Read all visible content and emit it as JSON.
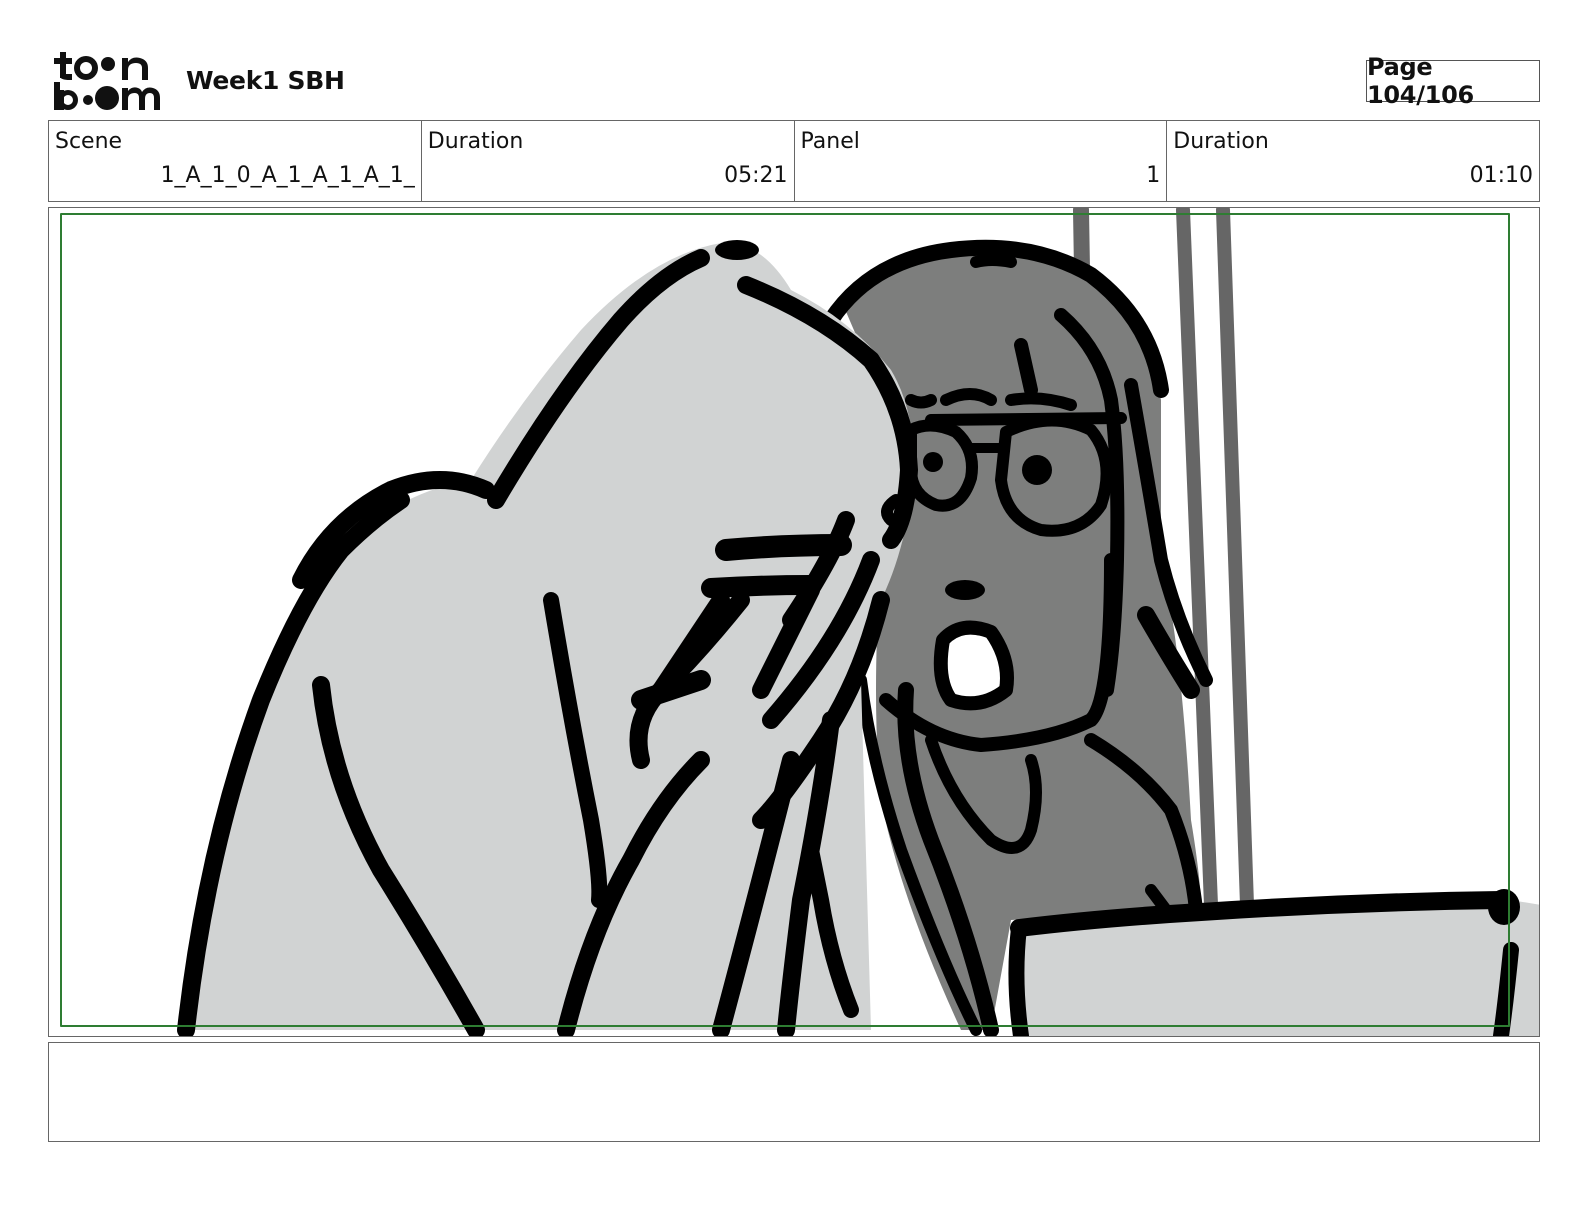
{
  "header": {
    "logo": {
      "text_top": "toon",
      "text_bottom": "boom",
      "icon": "toonboom-logo"
    },
    "project_title": "Week1 SBH",
    "page_label": "Page 104/106"
  },
  "info": {
    "scene": {
      "label": "Scene",
      "value": "1_A_1_0_A_1_A_1_A_1_"
    },
    "scene_duration": {
      "label": "Duration",
      "value": "05:21"
    },
    "panel": {
      "label": "Panel",
      "value": "1"
    },
    "panel_duration": {
      "label": "Duration",
      "value": "01:10"
    }
  },
  "drawing": {
    "description_icon": "storyboard-sketch",
    "colors": {
      "frame_green": "#2e7d32",
      "light_fill": "#d1d3d3",
      "dark_fill": "#7d7e7d",
      "ink": "#000000"
    }
  },
  "notes": {
    "text": ""
  }
}
